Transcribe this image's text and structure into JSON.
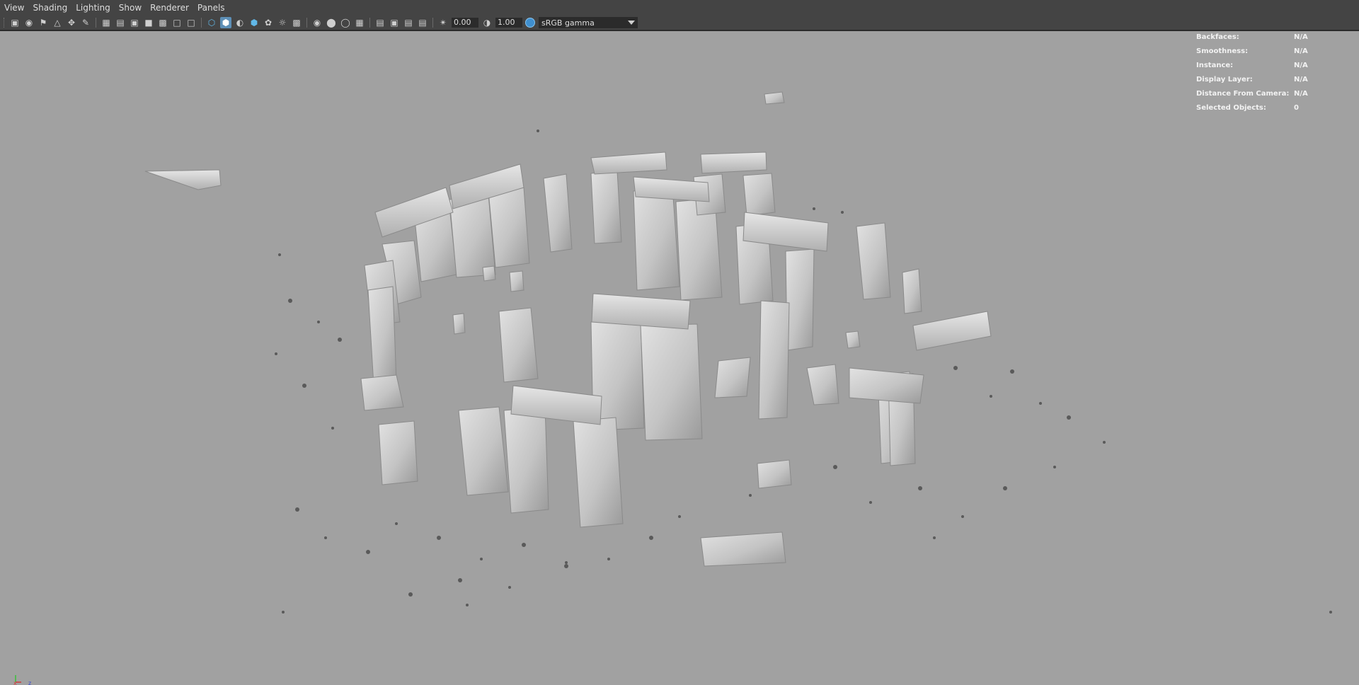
{
  "menubar": {
    "items": [
      "View",
      "Shading",
      "Lighting",
      "Show",
      "Renderer",
      "Panels"
    ]
  },
  "toolbar": {
    "exposure_value": "0.00",
    "gamma_value": "1.00",
    "view_transform": "sRGB gamma"
  },
  "hud": {
    "rows": [
      {
        "label": "Backfaces:",
        "value": "N/A"
      },
      {
        "label": "Smoothness:",
        "value": "N/A"
      },
      {
        "label": "Instance:",
        "value": "N/A"
      },
      {
        "label": "Display Layer:",
        "value": "N/A"
      },
      {
        "label": "Distance From Camera:",
        "value": "N/A"
      },
      {
        "label": "Selected Objects:",
        "value": "0"
      }
    ]
  },
  "axis": {
    "x_label": "x",
    "z_label": "z"
  },
  "colors": {
    "panel_bg": "#444444",
    "viewport_bg": "#a1a1a1",
    "stone_light": "#d4d4d4",
    "stone_shadow": "#8d8d8d",
    "accent": "#5d8fb6"
  }
}
